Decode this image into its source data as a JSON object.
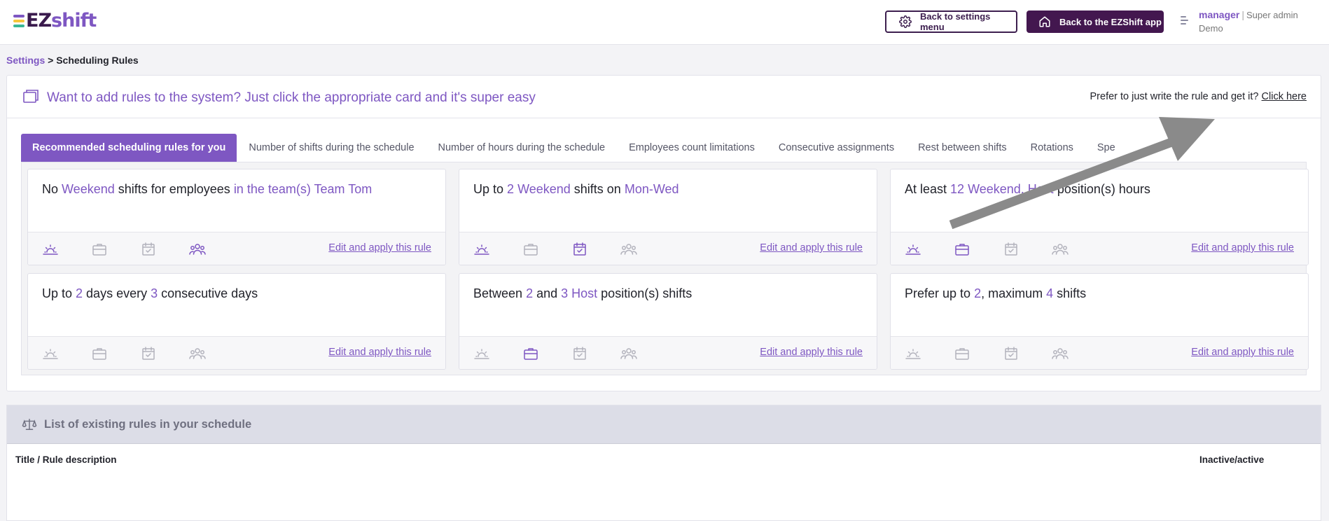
{
  "brand": {
    "logo_ez": "EZ",
    "logo_shift": "shift",
    "colors": {
      "primary": "#7e57c2",
      "dark": "#43174f",
      "logo_bars": [
        "#7e57c2",
        "#f7c63a",
        "#3ab795"
      ]
    }
  },
  "header": {
    "settings_button": "Back to settings menu",
    "settings_icon": "gear-icon",
    "app_button": "Back to the EZShift app",
    "app_icon": "home-icon",
    "user_name": "manager",
    "user_separator": "|",
    "user_role": "Super admin",
    "user_org": "Demo"
  },
  "breadcrumb": {
    "parent": "Settings",
    "separator": ">",
    "current": "Scheduling Rules"
  },
  "add_rules": {
    "title": "Want to add rules to the system? Just click the appropriate card and it's super easy",
    "hint": "Prefer to just write the rule and get it?",
    "hint_link": "Click here"
  },
  "tabs": [
    {
      "label": "Recommended scheduling rules for you",
      "active": true
    },
    {
      "label": "Number of shifts during the schedule"
    },
    {
      "label": "Number of hours during the schedule"
    },
    {
      "label": "Employees count limitations"
    },
    {
      "label": "Consecutive assignments"
    },
    {
      "label": "Rest between shifts"
    },
    {
      "label": "Rotations"
    },
    {
      "label": "Spe"
    }
  ],
  "rule_cards": [
    {
      "parts": [
        {
          "t": "No "
        },
        {
          "t": "Weekend",
          "v": true
        },
        {
          "t": " shifts for employees "
        },
        {
          "t": "in the team(s) Team Tom",
          "v": true
        }
      ],
      "icons_active": [
        true,
        false,
        false,
        true
      ],
      "edit": "Edit and apply this rule"
    },
    {
      "parts": [
        {
          "t": "Up to "
        },
        {
          "t": "2",
          "v": true
        },
        {
          "t": " "
        },
        {
          "t": "Weekend",
          "v": true
        },
        {
          "t": " shifts on "
        },
        {
          "t": "Mon-Wed",
          "v": true
        }
      ],
      "icons_active": [
        true,
        false,
        true,
        false
      ],
      "edit": "Edit and apply this rule"
    },
    {
      "parts": [
        {
          "t": "At least "
        },
        {
          "t": "12",
          "v": true
        },
        {
          "t": " "
        },
        {
          "t": "Weekend, Host",
          "v": true
        },
        {
          "t": " position(s) hours"
        }
      ],
      "icons_active": [
        true,
        true,
        false,
        false
      ],
      "edit": "Edit and apply this rule"
    },
    {
      "parts": [
        {
          "t": "Up to "
        },
        {
          "t": "2",
          "v": true
        },
        {
          "t": " days every "
        },
        {
          "t": "3",
          "v": true
        },
        {
          "t": " consecutive days"
        }
      ],
      "icons_active": [
        false,
        false,
        false,
        false
      ],
      "edit": "Edit and apply this rule"
    },
    {
      "parts": [
        {
          "t": "Between "
        },
        {
          "t": "2",
          "v": true
        },
        {
          "t": " and "
        },
        {
          "t": "3",
          "v": true
        },
        {
          "t": " "
        },
        {
          "t": "Host",
          "v": true
        },
        {
          "t": " position(s) shifts"
        }
      ],
      "icons_active": [
        false,
        true,
        false,
        false
      ],
      "edit": "Edit and apply this rule"
    },
    {
      "parts": [
        {
          "t": "Prefer up to "
        },
        {
          "t": "2",
          "v": true
        },
        {
          "t": ", maximum "
        },
        {
          "t": "4",
          "v": true
        },
        {
          "t": " shifts"
        }
      ],
      "icons_active": [
        false,
        false,
        false,
        false
      ],
      "edit": "Edit and apply this rule"
    }
  ],
  "card_icon_names": [
    "sunrise-icon",
    "briefcase-icon",
    "calendar-check-icon",
    "people-icon"
  ],
  "existing_rules": {
    "title": "List of existing rules in your schedule",
    "col_title": "Title / Rule description",
    "col_active": "Inactive/active"
  }
}
